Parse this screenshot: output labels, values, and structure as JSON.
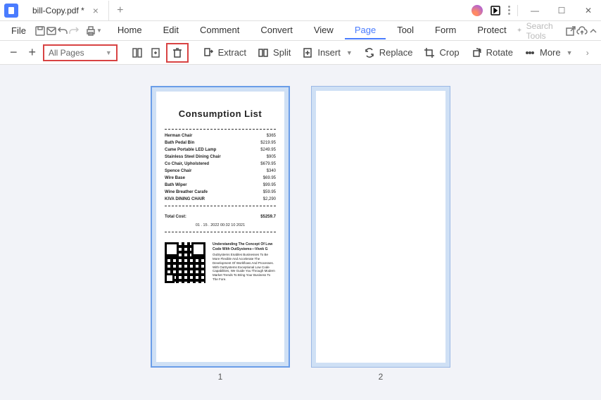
{
  "tab_title": "bill-Copy.pdf *",
  "menu": {
    "file": "File"
  },
  "tabs": {
    "home": "Home",
    "edit": "Edit",
    "comment": "Comment",
    "convert": "Convert",
    "view": "View",
    "page": "Page",
    "tool": "Tool",
    "form": "Form",
    "protect": "Protect"
  },
  "search_placeholder": "Search Tools",
  "page_selector": "All Pages",
  "toolbar": {
    "extract": "Extract",
    "split": "Split",
    "insert": "Insert",
    "replace": "Replace",
    "crop": "Crop",
    "rotate": "Rotate",
    "more": "More"
  },
  "pages": {
    "p1": "1",
    "p2": "2"
  },
  "invoice": {
    "title": "Consumption List",
    "items": [
      {
        "name": "Herman Chair",
        "price": "$365"
      },
      {
        "name": "Bath Pedal Bin",
        "price": "$219.95"
      },
      {
        "name": "Came Portable LED Lamp",
        "price": "$249.95"
      },
      {
        "name": "Stainless Steel Dining Chair",
        "price": "$905"
      },
      {
        "name": "Co Chair, Upholstered",
        "price": "$679.95"
      },
      {
        "name": "Spence Chair",
        "price": "$340"
      },
      {
        "name": "Wire Base",
        "price": "$69.95"
      },
      {
        "name": "Bath Wiper",
        "price": "$99.95"
      },
      {
        "name": "Wine Breather Carafe",
        "price": "$59.95"
      },
      {
        "name": "KIVA DINING CHAIR",
        "price": "$2,290"
      }
    ],
    "total_label": "Total Cost:",
    "total_value": "$5259.7",
    "date": "01 . 15 . 2022  00:32  10 2021",
    "desc_title": "Understanding The Concept Of Low Code With OutSystems—Vivek G",
    "desc_body": "OutSystems Enables Businesses To Be More Flexible And Accelerate The Development Of Workflows And Processes. With OutSystems Exceptional Low Code Capabilities, We Guide You Through Modern Market Trends To Bring Your Business To The Fore."
  }
}
